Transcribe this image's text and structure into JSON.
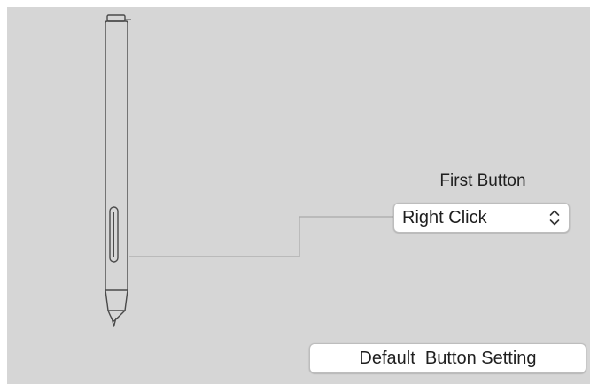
{
  "panel": {
    "background": "#d6d6d6"
  },
  "pen": {
    "icon": "stylus-pen-icon"
  },
  "first_button": {
    "label": "First Button",
    "selected_value": "Right Click",
    "arrows_icon": "up-down-chevron-icon"
  },
  "default_button": {
    "label": "Default  Button Setting"
  }
}
